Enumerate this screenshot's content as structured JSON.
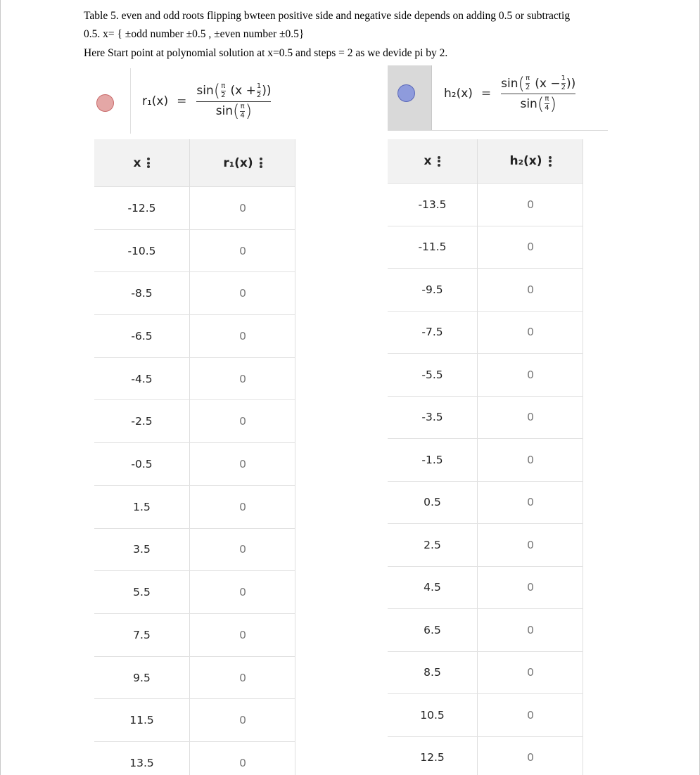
{
  "caption": {
    "line1": "Table 5. even and odd roots flipping bwteen positive side and negative side depends on adding 0.5 or subtractig",
    "line2": "0.5. x= { ±odd number ±0.5 , ±even number ±0.5}",
    "line3": "Here Start point at polynomial solution at x=0.5 and steps = 2 as we devide pi by 2."
  },
  "left": {
    "dot_color": "#e4a7a6",
    "dot_border": "#c96b6b",
    "function": {
      "lhs": "r₁(x)",
      "eq": "=",
      "num_prefix": "sin",
      "num_pi": "π",
      "num_pi_den": "2",
      "num_mid": "(x +",
      "num_one": "1",
      "num_one_den": "2",
      "num_close": "))",
      "den_prefix": "sin",
      "den_pi": "π",
      "den_pi_den": "4"
    },
    "table": {
      "col_x": "x",
      "col_y": "r₁(x)",
      "rows": [
        [
          "-12.5",
          "0"
        ],
        [
          "-10.5",
          "0"
        ],
        [
          "-8.5",
          "0"
        ],
        [
          "-6.5",
          "0"
        ],
        [
          "-4.5",
          "0"
        ],
        [
          "-2.5",
          "0"
        ],
        [
          "-0.5",
          "0"
        ],
        [
          "1.5",
          "0"
        ],
        [
          "3.5",
          "0"
        ],
        [
          "5.5",
          "0"
        ],
        [
          "7.5",
          "0"
        ],
        [
          "9.5",
          "0"
        ],
        [
          "11.5",
          "0"
        ],
        [
          "13.5",
          "0"
        ]
      ]
    }
  },
  "right": {
    "dot_color": "#8e9bdc",
    "dot_border": "#5a67b8",
    "function": {
      "lhs": "h₂(x)",
      "eq": "=",
      "num_prefix": "sin",
      "num_pi": "π",
      "num_pi_den": "2",
      "num_mid": "(x −",
      "num_one": "1",
      "num_one_den": "2",
      "num_close": "))",
      "den_prefix": "sin",
      "den_pi": "π",
      "den_pi_den": "4"
    },
    "table": {
      "col_x": "x",
      "col_y": "h₂(x)",
      "rows": [
        [
          "-13.5",
          "0"
        ],
        [
          "-11.5",
          "0"
        ],
        [
          "-9.5",
          "0"
        ],
        [
          "-7.5",
          "0"
        ],
        [
          "-5.5",
          "0"
        ],
        [
          "-3.5",
          "0"
        ],
        [
          "-1.5",
          "0"
        ],
        [
          "0.5",
          "0"
        ],
        [
          "2.5",
          "0"
        ],
        [
          "4.5",
          "0"
        ],
        [
          "6.5",
          "0"
        ],
        [
          "8.5",
          "0"
        ],
        [
          "10.5",
          "0"
        ],
        [
          "12.5",
          "0"
        ]
      ]
    }
  }
}
